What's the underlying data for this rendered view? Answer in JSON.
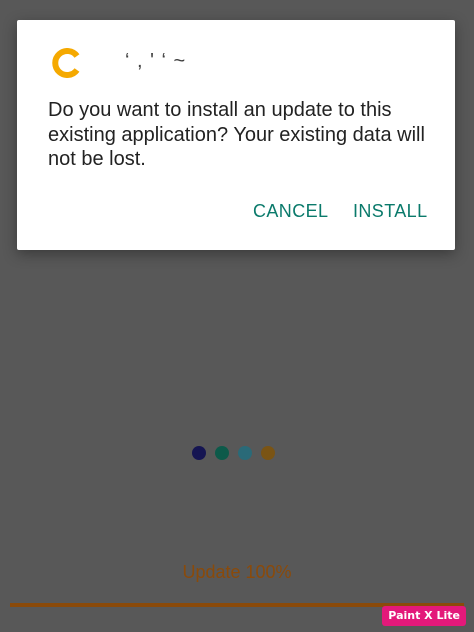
{
  "dialog": {
    "app_name": "‘ , ' ‘  ~",
    "app_icon": "app-logo-icon",
    "message": "Do you want to install an update to this existing application? Your existing data will not be lost.",
    "cancel_label": "CANCEL",
    "install_label": "INSTALL",
    "button_color": "#0a7a6b"
  },
  "loader": {
    "dot_colors": [
      "#151552",
      "#0d5a4a",
      "#2a6a78",
      "#7a5414"
    ]
  },
  "update": {
    "status_text": "Update 100%",
    "progress": 1.0,
    "color": "#8a4a0a"
  },
  "watermark": {
    "text": "Paint X Lite"
  },
  "colors": {
    "scrim": "#585858",
    "dialog_bg": "#ffffff",
    "app_icon": "#f5a900"
  }
}
